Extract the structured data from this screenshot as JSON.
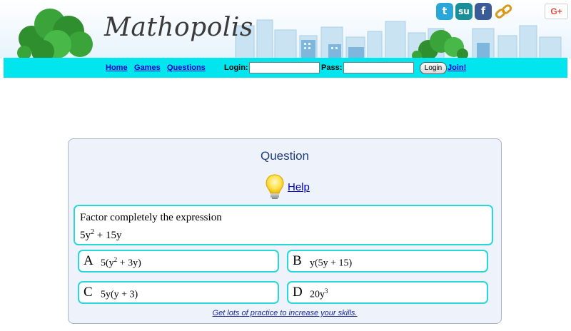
{
  "header": {
    "logo_text": "Mathopolis",
    "social_icons": [
      "twitter-icon",
      "stumbleupon-icon",
      "facebook-icon",
      "link-icon"
    ],
    "gplus_label": "G+"
  },
  "nav": {
    "home": "Home",
    "games": "Games",
    "questions": "Questions",
    "login_label": "Login:",
    "login_value": "",
    "pass_label": "Pass:",
    "pass_value": "",
    "login_button": "Login",
    "join": "Join!"
  },
  "question": {
    "title": "Question",
    "help": "Help",
    "prompt_text": "Factor completely the expression",
    "prompt_expr_prefix": "5y",
    "prompt_expr_sup": "2",
    "prompt_expr_suffix": " + 15y",
    "answers": [
      {
        "letter": "A",
        "pre": "5(y",
        "sup": "2",
        "post": " + 3y)"
      },
      {
        "letter": "B",
        "pre": "y(5y + 15)",
        "sup": "",
        "post": ""
      },
      {
        "letter": "C",
        "pre": "5y(y + 3)",
        "sup": "",
        "post": ""
      },
      {
        "letter": "D",
        "pre": "20y",
        "sup": "3",
        "post": ""
      }
    ],
    "footer": "Get lots of practice to increase your skills."
  },
  "colors": {
    "nav_bar": "#00e5ee",
    "answer_border": "#29d6d9",
    "panel_bg": "#eef3fb",
    "link": "#0000cc"
  }
}
